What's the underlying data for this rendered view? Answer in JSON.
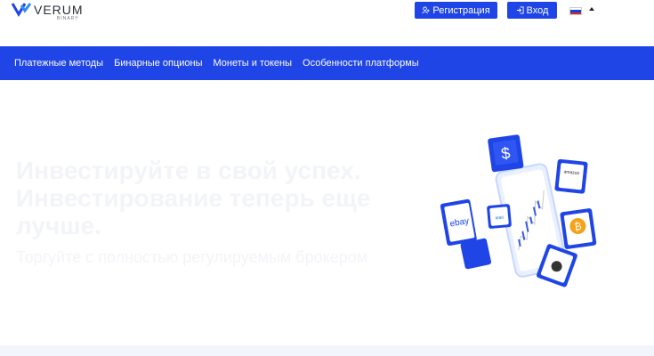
{
  "header": {
    "logo_name": "VERUM",
    "logo_sub": "BINARY",
    "register_label": "Регистрация",
    "login_label": "Вход",
    "language": "RU"
  },
  "nav": {
    "items": [
      {
        "label": "Платежные методы"
      },
      {
        "label": "Бинарные опционы"
      },
      {
        "label": "Монеты и токены"
      },
      {
        "label": "Особенности платформы"
      }
    ]
  },
  "hero": {
    "title": "Инвестируйте в свой успех. Инвестирование теперь еще лучше.",
    "subtitle": "Торгуйте с полностью регулируемым брокером"
  },
  "illustration": {
    "cards": [
      "dollar-icon",
      "amazon-logo",
      "ebay-logo",
      "intel-logo",
      "bitcoin-icon",
      "apple-icon"
    ],
    "card_texts": {
      "ebay": "ebay",
      "amazon": "amazon",
      "intel": "intel"
    }
  },
  "colors": {
    "brand": "#1f45e6",
    "hero_text": "#f2f4f8"
  }
}
